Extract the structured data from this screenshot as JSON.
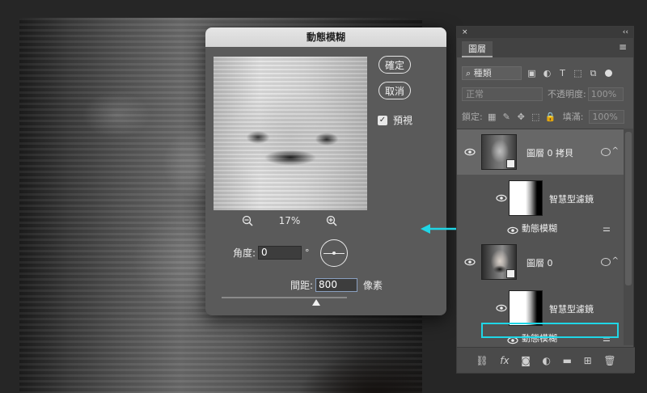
{
  "dialog": {
    "title": "動態模糊",
    "ok_label": "確定",
    "cancel_label": "取消",
    "preview_label": "預視",
    "preview_checked": true,
    "zoom_value": "17%",
    "angle_label": "角度:",
    "angle_value": "0",
    "angle_unit": "°",
    "distance_label": "間距:",
    "distance_value": "800",
    "distance_unit": "像素"
  },
  "arrow_color": "#1fd6e6",
  "panel": {
    "close_glyph": "×",
    "collapse_glyph": "‹‹",
    "tab_label": "圖層",
    "filter_kind": "種類",
    "blend_mode": "正常",
    "opacity_label": "不透明度:",
    "opacity_value": "100%",
    "lock_label": "鎖定:",
    "fill_label": "填滿:",
    "fill_value": "100%",
    "layers": [
      {
        "name": "圖層 0 拷貝",
        "filters_label": "智慧型濾鏡",
        "filter_name": "動態模糊",
        "selected": true
      },
      {
        "name": "圖層 0",
        "filters_label": "智慧型濾鏡",
        "filter_name": "動態模糊",
        "selected": false
      }
    ],
    "bottom_icons": [
      "link-icon",
      "fx-icon",
      "mask-icon",
      "adjustment-icon",
      "folder-icon",
      "new-layer-icon",
      "trash-icon"
    ],
    "bottom_fx": "fx"
  }
}
